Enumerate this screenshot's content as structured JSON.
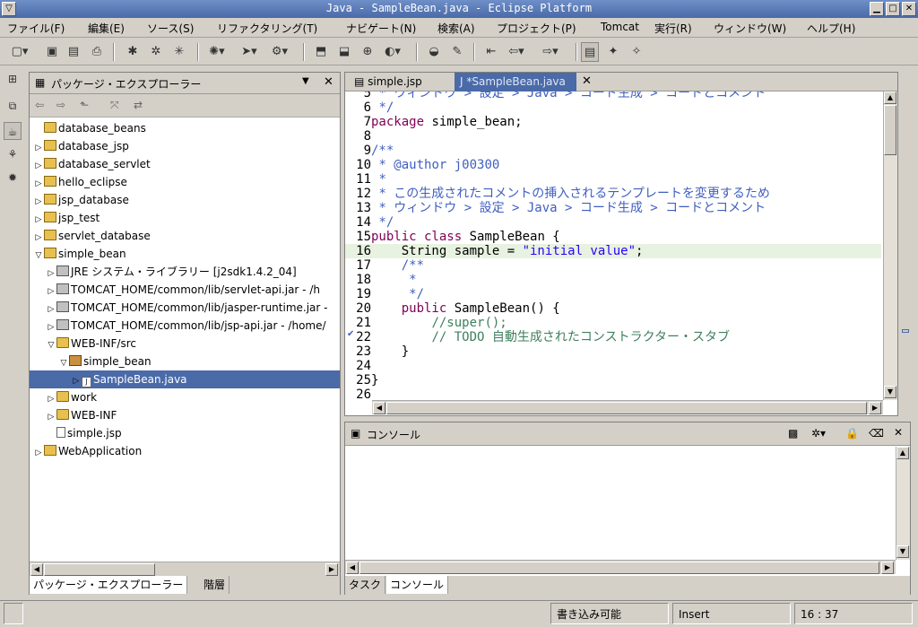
{
  "window": {
    "title": "Java - SampleBean.java - Eclipse Platform"
  },
  "menu": [
    "ファイル(F)",
    "編集(E)",
    "ソース(S)",
    "リファクタリング(T)",
    "ナビゲート(N)",
    "検索(A)",
    "プロジェクト(P)",
    "Tomcat",
    "実行(R)",
    "ウィンドウ(W)",
    "ヘルプ(H)"
  ],
  "package_explorer": {
    "title": "パッケージ・エクスプローラー",
    "tree": [
      {
        "label": "database_beans",
        "icon": "folder",
        "level": 0,
        "twisty": ""
      },
      {
        "label": "database_jsp",
        "icon": "proj",
        "level": 0,
        "twisty": "▷"
      },
      {
        "label": "database_servlet",
        "icon": "proj",
        "level": 0,
        "twisty": "▷"
      },
      {
        "label": "hello_eclipse",
        "icon": "proj",
        "level": 0,
        "twisty": "▷"
      },
      {
        "label": "jsp_database",
        "icon": "proj",
        "level": 0,
        "twisty": "▷"
      },
      {
        "label": "jsp_test",
        "icon": "proj",
        "level": 0,
        "twisty": "▷"
      },
      {
        "label": "servlet_database",
        "icon": "proj",
        "level": 0,
        "twisty": "▷"
      },
      {
        "label": "simple_bean",
        "icon": "proj",
        "level": 0,
        "twisty": "▽"
      },
      {
        "label": "JRE システム・ライブラリー [j2sdk1.4.2_04]",
        "icon": "jar",
        "level": 1,
        "twisty": "▷"
      },
      {
        "label": "TOMCAT_HOME/common/lib/servlet-api.jar - /h",
        "icon": "jar",
        "level": 1,
        "twisty": "▷"
      },
      {
        "label": "TOMCAT_HOME/common/lib/jasper-runtime.jar -",
        "icon": "jar",
        "level": 1,
        "twisty": "▷"
      },
      {
        "label": "TOMCAT_HOME/common/lib/jsp-api.jar - /home/",
        "icon": "jar",
        "level": 1,
        "twisty": "▷"
      },
      {
        "label": "WEB-INF/src",
        "icon": "folder",
        "level": 1,
        "twisty": "▽"
      },
      {
        "label": "simple_bean",
        "icon": "pkgi",
        "level": 2,
        "twisty": "▽"
      },
      {
        "label": "SampleBean.java",
        "icon": "java",
        "level": 3,
        "twisty": "▷",
        "selected": true
      },
      {
        "label": "work",
        "icon": "folder",
        "level": 1,
        "twisty": "▷"
      },
      {
        "label": "WEB-INF",
        "icon": "folder",
        "level": 1,
        "twisty": "▷"
      },
      {
        "label": "simple.jsp",
        "icon": "file",
        "level": 1,
        "twisty": ""
      },
      {
        "label": "WebApplication",
        "icon": "proj",
        "level": 0,
        "twisty": "▷"
      }
    ],
    "bottom_tabs": [
      "パッケージ・エクスプローラー",
      "階層"
    ]
  },
  "editor": {
    "tabs": [
      {
        "label": "simple.jsp",
        "active": false
      },
      {
        "label": "*SampleBean.java",
        "active": true
      }
    ],
    "lines": [
      {
        "n": "5",
        "html": " <span class=\"cm\">* ウィンドウ > 設定 > Java > コード生成 > コードとコメント</span>"
      },
      {
        "n": "6",
        "html": " <span class=\"cm\">*/</span>"
      },
      {
        "n": "7",
        "html": "<span class=\"kw\">package</span> simple_bean;"
      },
      {
        "n": "8",
        "html": ""
      },
      {
        "n": "9",
        "html": "<span class=\"cm\">/**</span>"
      },
      {
        "n": "10",
        "html": " <span class=\"cm\">* @author j00300</span>"
      },
      {
        "n": "11",
        "html": " <span class=\"cm\">*</span>"
      },
      {
        "n": "12",
        "html": " <span class=\"cm\">* この生成されたコメントの挿入されるテンプレートを変更するため</span>"
      },
      {
        "n": "13",
        "html": " <span class=\"cm\">* ウィンドウ > 設定 > Java > コード生成 > コードとコメント</span>"
      },
      {
        "n": "14",
        "html": " <span class=\"cm\">*/</span>"
      },
      {
        "n": "15",
        "html": "<span class=\"kw\">public class</span> SampleBean {"
      },
      {
        "n": "16",
        "html": "    String sample = <span class=\"str\">\"initial value\"</span>;",
        "current": true
      },
      {
        "n": "17",
        "html": "    <span class=\"cm\">/**</span>"
      },
      {
        "n": "18",
        "html": "     <span class=\"cm\">*</span>"
      },
      {
        "n": "19",
        "html": "     <span class=\"cm\">*/</span>"
      },
      {
        "n": "20",
        "html": "    <span class=\"kw\">public</span> SampleBean() {"
      },
      {
        "n": "21",
        "html": "        <span class=\"cm2\">//super();</span>"
      },
      {
        "n": "22",
        "html": "        <span class=\"cm2\">// TODO 自動生成されたコンストラクター・スタブ</span>"
      },
      {
        "n": "23",
        "html": "    }"
      },
      {
        "n": "24",
        "html": ""
      },
      {
        "n": "25",
        "html": "}"
      },
      {
        "n": "26",
        "html": ""
      }
    ]
  },
  "console": {
    "title": "コンソール",
    "bottom_tabs": [
      "タスク",
      "コンソール"
    ]
  },
  "status": {
    "writable": "書き込み可能",
    "mode": "Insert",
    "position": "16 : 37"
  }
}
